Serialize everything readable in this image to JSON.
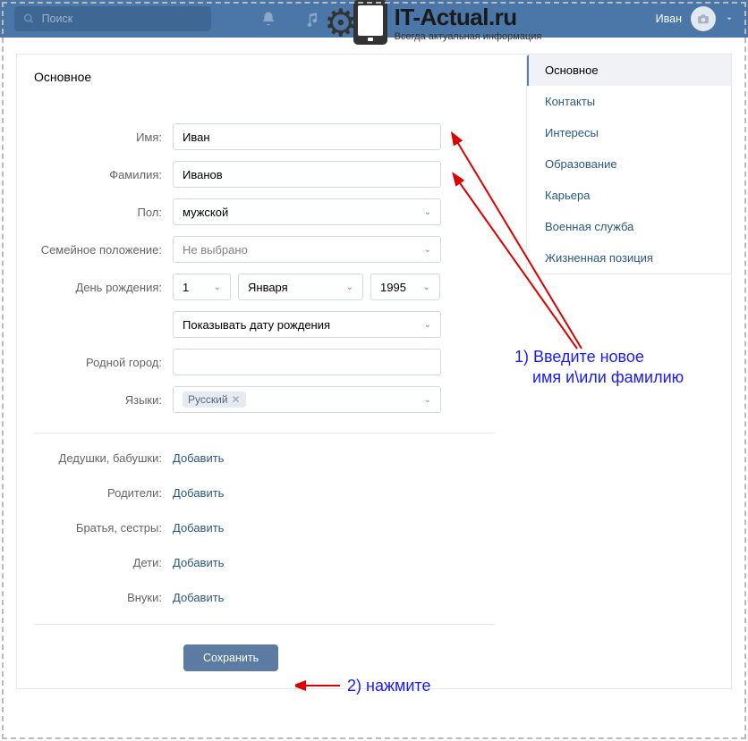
{
  "topbar": {
    "search_placeholder": "Поиск",
    "user_name": "Иван"
  },
  "watermark": {
    "title": "IT-Actual.ru",
    "subtitle": "Всегда актуальная информация"
  },
  "page_title": "Основное",
  "form": {
    "labels": {
      "first_name": "Имя:",
      "last_name": "Фамилия:",
      "sex": "Пол:",
      "marital": "Семейное положение:",
      "birthday": "День рождения:",
      "hometown": "Родной город:",
      "languages": "Языки:",
      "grandparents": "Дедушки, бабушки:",
      "parents": "Родители:",
      "siblings": "Братья, сестры:",
      "children": "Дети:",
      "grandchildren": "Внуки:"
    },
    "values": {
      "first_name": "Иван",
      "last_name": "Иванов",
      "sex": "мужской",
      "marital": "Не выбрано",
      "bday_day": "1",
      "bday_month": "Января",
      "bday_year": "1995",
      "bday_visibility": "Показывать дату рождения",
      "hometown": "",
      "language_tag": "Русский"
    },
    "add_link": "Добавить",
    "save_button": "Сохранить"
  },
  "side_menu": {
    "items": [
      "Основное",
      "Контакты",
      "Интересы",
      "Образование",
      "Карьера",
      "Военная служба",
      "Жизненная позиция"
    ]
  },
  "annotations": {
    "step1": "1) Введите новое\n    имя и\\или фамилию",
    "step2": "2) нажмите"
  }
}
